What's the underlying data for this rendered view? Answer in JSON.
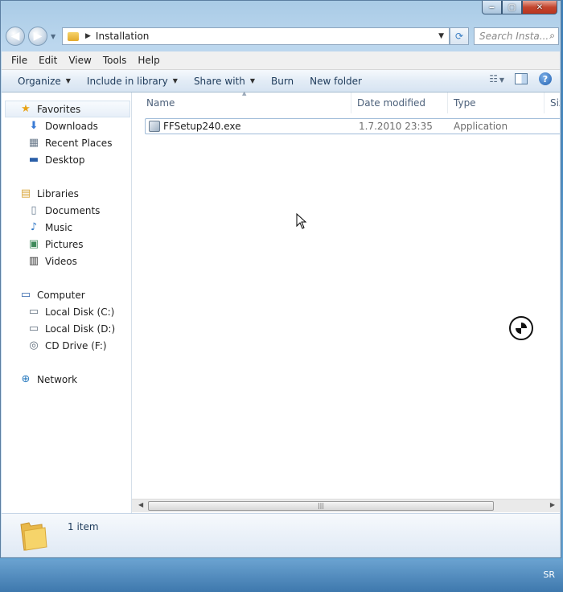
{
  "window": {
    "caption_buttons": {
      "minimize": "‒",
      "maximize": "▢",
      "close": "✕"
    }
  },
  "address_bar": {
    "breadcrumb": "Installation",
    "search_placeholder": "Search Insta..."
  },
  "menu": [
    "File",
    "Edit",
    "View",
    "Tools",
    "Help"
  ],
  "toolbar": {
    "organize": "Organize",
    "include_in_library": "Include in library",
    "share_with": "Share with",
    "burn": "Burn",
    "new_folder": "New folder"
  },
  "nav": {
    "favorites": {
      "label": "Favorites",
      "items": [
        "Downloads",
        "Recent Places",
        "Desktop"
      ]
    },
    "libraries": {
      "label": "Libraries",
      "items": [
        "Documents",
        "Music",
        "Pictures",
        "Videos"
      ]
    },
    "computer": {
      "label": "Computer",
      "items": [
        "Local Disk (C:)",
        "Local Disk (D:)",
        "CD Drive (F:)"
      ]
    },
    "network": {
      "label": "Network"
    }
  },
  "columns": {
    "name": "Name",
    "date": "Date modified",
    "type": "Type",
    "size": "Size"
  },
  "files": [
    {
      "name": "FFSetup240.exe",
      "date": "1.7.2010 23:35",
      "type": "Application"
    }
  ],
  "details": {
    "count": "1 item"
  },
  "taskbar": {
    "language": "SR"
  },
  "colors": {
    "accent": "#3b7fc4",
    "window_frame": "#bcd7ee"
  }
}
